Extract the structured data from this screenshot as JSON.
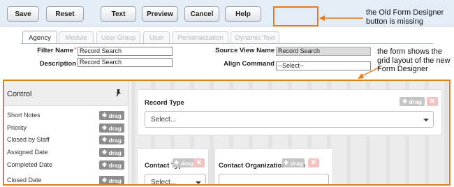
{
  "toolbar": {
    "buttons": [
      "Save",
      "Reset",
      "Text",
      "Preview",
      "Cancel",
      "Help"
    ]
  },
  "annotations": {
    "missing_button": "the Old Form Designer button is missing",
    "grid_layout": "the form shows the grid layout of the new Form Designer"
  },
  "tabs": [
    "Agency",
    "Module",
    "User Group",
    "User",
    "Personalization",
    "Dynamic Text"
  ],
  "form": {
    "filter_name_label": "Filter Name",
    "required_mark": "*",
    "filter_name_value": "Record Search",
    "description_label": "Description",
    "description_value": "Record Search",
    "source_view_label": "Source View Name",
    "source_view_value": "Record Search",
    "align_command_label": "Align Command",
    "align_command_value": "--Select--"
  },
  "designer": {
    "control_title": "Control",
    "drag_label": "drag",
    "controls": [
      "Short Notes",
      "Priority",
      "Closed by Staff",
      "Assigned Date",
      "Completed Date",
      "Closed Date"
    ],
    "cards": {
      "record_type_title": "Record Type",
      "record_type_value": "Select...",
      "contact_type_title": "Contact Type",
      "contact_type_value": "Select...",
      "contact_org_title": "Contact Organization Name"
    },
    "remove_symbol": "✕"
  },
  "icons": [
    "pin-icon",
    "drag-icon",
    "close-icon",
    "chevron-down-icon"
  ],
  "colors": {
    "highlight": "#e07d1e",
    "toolbar_bg": "#e4ecf5",
    "drag_badge": "#8d8d8d",
    "remove_badge": "#f3c3c3"
  }
}
